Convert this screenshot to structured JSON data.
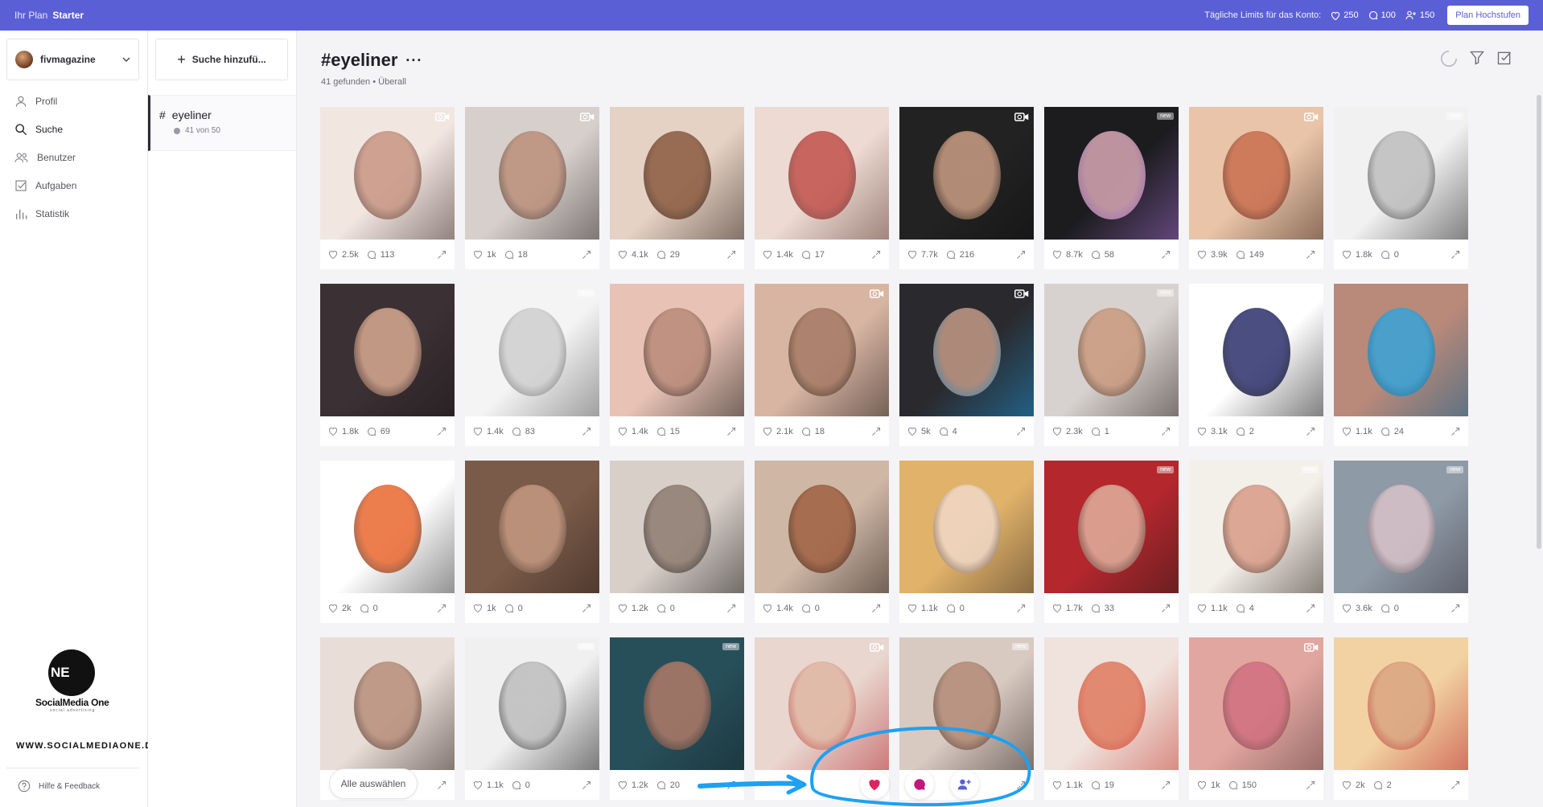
{
  "topbar": {
    "plan_label": "Ihr Plan",
    "plan_name": "Starter",
    "limits_label": "Tägliche Limits für das Konto:",
    "likes_limit": "250",
    "comments_limit": "100",
    "follows_limit": "150",
    "upgrade_label": "Plan Hochstufen"
  },
  "account": {
    "name": "fivmagazine"
  },
  "nav": [
    {
      "label": "Profil",
      "icon": "user-icon"
    },
    {
      "label": "Suche",
      "icon": "search-icon"
    },
    {
      "label": "Benutzer",
      "icon": "users-icon"
    },
    {
      "label": "Aufgaben",
      "icon": "tasks-icon"
    },
    {
      "label": "Statistik",
      "icon": "stats-icon"
    }
  ],
  "brand": {
    "mark": "NE",
    "name": "SocialMedia One",
    "tagline": "social advertising",
    "url": "WWW.SOCIALMEDIAONE.DE"
  },
  "help_label": "Hilfe & Feedback",
  "searches": {
    "add_label": "Suche hinzufü...",
    "active": {
      "tag": "eyeliner",
      "count": "41 von 50"
    }
  },
  "main": {
    "title": "#eyeliner",
    "found": "41 gefunden",
    "scope": "Überall",
    "select_all_label": "Alle auswählen"
  },
  "colors": {
    "topbar": "#5b5fd6",
    "like": "#e0245e",
    "comment": "#c2187a",
    "follow": "#5b5fd6",
    "annotation": "#1da1f2"
  },
  "posts": [
    {
      "likes": "2.5k",
      "comments": "113",
      "badge": "video",
      "palette": [
        "#f2e6e1",
        "#c79583",
        "#3b2a26"
      ]
    },
    {
      "likes": "1k",
      "comments": "18",
      "badge": "video",
      "palette": [
        "#d6cfcc",
        "#bb8f7a",
        "#2e2828"
      ]
    },
    {
      "likes": "4.1k",
      "comments": "29",
      "badge": "",
      "palette": [
        "#e5d2c4",
        "#8a5a3f",
        "#2b1d18"
      ]
    },
    {
      "likes": "1.4k",
      "comments": "17",
      "badge": "",
      "palette": [
        "#eddad2",
        "#c0504a",
        "#5a3a33"
      ]
    },
    {
      "likes": "7.7k",
      "comments": "216",
      "badge": "video",
      "palette": [
        "#222222",
        "#cc9e85",
        "#0d0d0d"
      ]
    },
    {
      "likes": "8.7k",
      "comments": "58",
      "badge": "new",
      "palette": [
        "#1c1c1f",
        "#d9a8b6",
        "#a06cc9"
      ]
    },
    {
      "likes": "3.9k",
      "comments": "149",
      "badge": "video",
      "palette": [
        "#e9c4a8",
        "#c96e4f",
        "#3b2218"
      ]
    },
    {
      "likes": "1.8k",
      "comments": "0",
      "badge": "new",
      "palette": [
        "#f1f1f1",
        "#bdbdbd",
        "#1e1e1e"
      ]
    },
    {
      "likes": "1.8k",
      "comments": "69",
      "badge": "",
      "palette": [
        "#3b3033",
        "#d9aa92",
        "#1b1518"
      ]
    },
    {
      "likes": "1.4k",
      "comments": "83",
      "badge": "new",
      "palette": [
        "#f4f4f4",
        "#cfcfcf",
        "#555555"
      ]
    },
    {
      "likes": "1.4k",
      "comments": "15",
      "badge": "",
      "palette": [
        "#e8c3b5",
        "#b88a79",
        "#121212"
      ]
    },
    {
      "likes": "2.1k",
      "comments": "18",
      "badge": "video",
      "palette": [
        "#d8b5a3",
        "#a57a64",
        "#1b1512"
      ]
    },
    {
      "likes": "5k",
      "comments": "4",
      "badge": "video",
      "palette": [
        "#2a2a2e",
        "#c39a86",
        "#1d8fd3"
      ]
    },
    {
      "likes": "2.3k",
      "comments": "1",
      "badge": "new",
      "palette": [
        "#d7d2cf",
        "#c9997d",
        "#2d201b"
      ]
    },
    {
      "likes": "3.1k",
      "comments": "2",
      "badge": "new",
      "palette": [
        "#ffffff",
        "#2b2f6b",
        "#111111"
      ]
    },
    {
      "likes": "1.1k",
      "comments": "24",
      "badge": "",
      "palette": [
        "#b9897a",
        "#36a4d8",
        "#0f5f8a"
      ]
    },
    {
      "likes": "2k",
      "comments": "0",
      "badge": "",
      "palette": [
        "#ffffff",
        "#e9662e",
        "#333333"
      ]
    },
    {
      "likes": "1k",
      "comments": "0",
      "badge": "",
      "palette": [
        "#7a5a48",
        "#c59a82",
        "#2a1e19"
      ]
    },
    {
      "likes": "1.2k",
      "comments": "0",
      "badge": "",
      "palette": [
        "#d9cfc9",
        "#8e7c71",
        "#151515"
      ]
    },
    {
      "likes": "1.4k",
      "comments": "0",
      "badge": "",
      "palette": [
        "#cfb7a6",
        "#a06040",
        "#1c1410"
      ]
    },
    {
      "likes": "1.1k",
      "comments": "0",
      "badge": "",
      "palette": [
        "#e0b26a",
        "#f0d8c8",
        "#3a2a1f"
      ]
    },
    {
      "likes": "1.7k",
      "comments": "33",
      "badge": "new",
      "palette": [
        "#b3272d",
        "#e0b19e",
        "#2a1818"
      ]
    },
    {
      "likes": "1.1k",
      "comments": "4",
      "badge": "new",
      "palette": [
        "#f3efe9",
        "#d89b86",
        "#2a1d16"
      ]
    },
    {
      "likes": "3.6k",
      "comments": "0",
      "badge": "new",
      "palette": [
        "#8e9aa6",
        "#d8c2c8",
        "#3a3340"
      ]
    },
    {
      "likes": "",
      "comments": "",
      "badge": "",
      "palette": [
        "#e8ddd7",
        "#b98e7b",
        "#2a1e1a"
      ]
    },
    {
      "likes": "1.1k",
      "comments": "0",
      "badge": "new",
      "palette": [
        "#f0f0f0",
        "#bdbdbd",
        "#111111"
      ]
    },
    {
      "likes": "1.2k",
      "comments": "20",
      "badge": "new",
      "palette": [
        "#274f5a",
        "#b07a67",
        "#15242a"
      ]
    },
    {
      "likes": "",
      "comments": "",
      "badge": "video",
      "palette": [
        "#e9d6cf",
        "#e0b6a3",
        "#b3272d"
      ]
    },
    {
      "likes": "",
      "comments": "",
      "badge": "new",
      "palette": [
        "#d8c9c1",
        "#b48b77",
        "#2b211d"
      ]
    },
    {
      "likes": "1.1k",
      "comments": "19",
      "badge": "",
      "palette": [
        "#f0e2dc",
        "#e07a5e",
        "#c34035"
      ]
    },
    {
      "likes": "1k",
      "comments": "150",
      "badge": "video",
      "palette": [
        "#e2a6a0",
        "#cf6f7e",
        "#5a3d3a"
      ]
    },
    {
      "likes": "2k",
      "comments": "2",
      "badge": "",
      "palette": [
        "#f2d2a2",
        "#d9a480",
        "#b71e24"
      ]
    }
  ]
}
